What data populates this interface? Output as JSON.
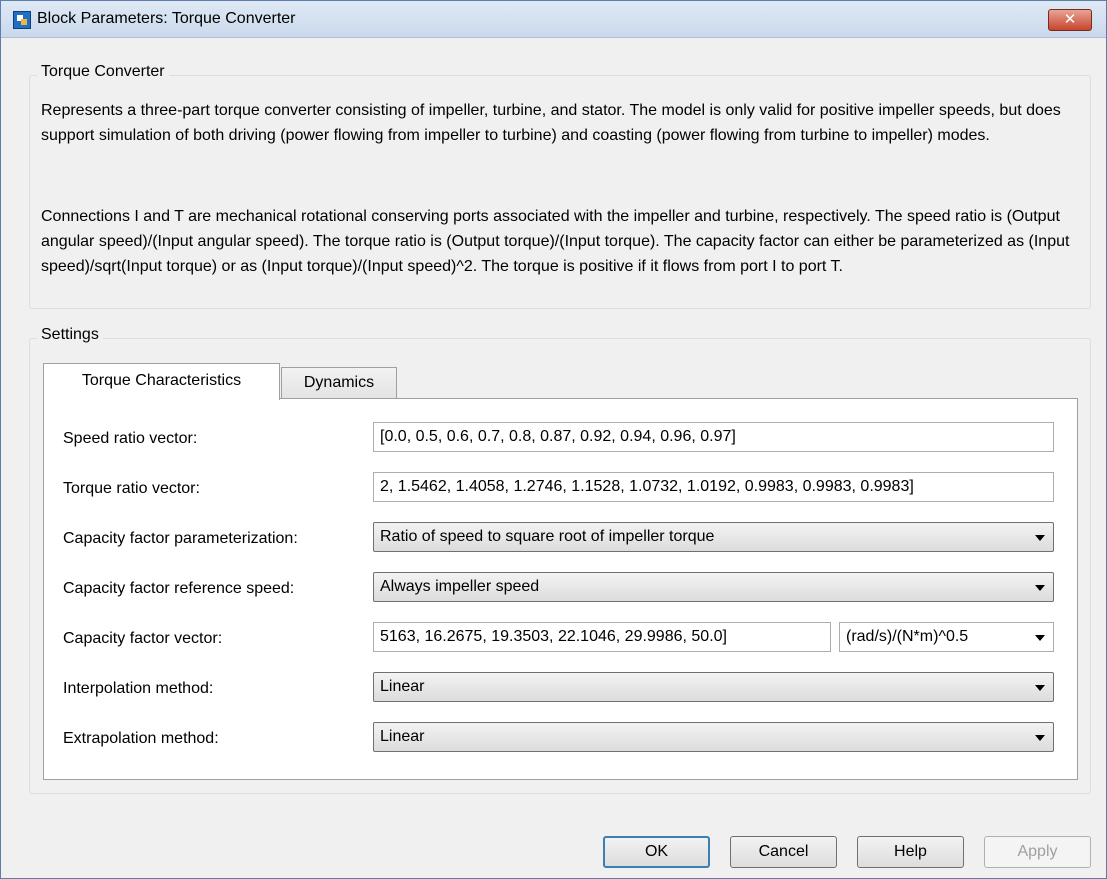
{
  "window": {
    "title": "Block Parameters: Torque Converter",
    "close_label": "✕"
  },
  "block_group": {
    "label": "Torque Converter",
    "desc1": "Represents a three-part torque converter consisting of impeller, turbine, and stator. The model is only valid for positive impeller speeds, but does support simulation of both driving (power flowing from impeller to turbine) and coasting (power flowing from turbine to impeller) modes.",
    "desc2": "Connections I and T are mechanical rotational conserving ports associated with the impeller and turbine, respectively. The speed ratio is (Output angular speed)/(Input angular speed). The torque ratio is (Output torque)/(Input torque). The capacity factor can either be parameterized as (Input speed)/sqrt(Input torque) or as (Input torque)/(Input speed)^2. The torque is positive if it flows from port I to port T."
  },
  "settings": {
    "label": "Settings",
    "tabs": [
      {
        "label": "Torque Characteristics"
      },
      {
        "label": "Dynamics"
      }
    ],
    "rows": {
      "speed_ratio": {
        "label": "Speed ratio vector:",
        "value": "[0.0, 0.5, 0.6, 0.7, 0.8, 0.87, 0.92, 0.94, 0.96, 0.97]"
      },
      "torque_ratio": {
        "label": "Torque ratio vector:",
        "value": "2, 1.5462, 1.4058, 1.2746, 1.1528, 1.0732, 1.0192, 0.9983, 0.9983, 0.9983]"
      },
      "cf_param": {
        "label": "Capacity factor parameterization:",
        "value": "Ratio of speed to square root of impeller torque"
      },
      "cf_ref_speed": {
        "label": "Capacity factor reference speed:",
        "value": "Always impeller speed"
      },
      "cf_vector": {
        "label": "Capacity factor vector:",
        "value": "5163, 16.2675, 19.3503, 22.1046, 29.9986, 50.0]",
        "unit": "(rad/s)/(N*m)^0.5"
      },
      "interp": {
        "label": "Interpolation method:",
        "value": "Linear"
      },
      "extrap": {
        "label": "Extrapolation method:",
        "value": "Linear"
      }
    }
  },
  "buttons": {
    "ok": "OK",
    "cancel": "Cancel",
    "help": "Help",
    "apply": "Apply"
  },
  "icons": {
    "app": "block-parameters-icon",
    "close": "close-icon",
    "dropdown": "chevron-down-icon"
  }
}
